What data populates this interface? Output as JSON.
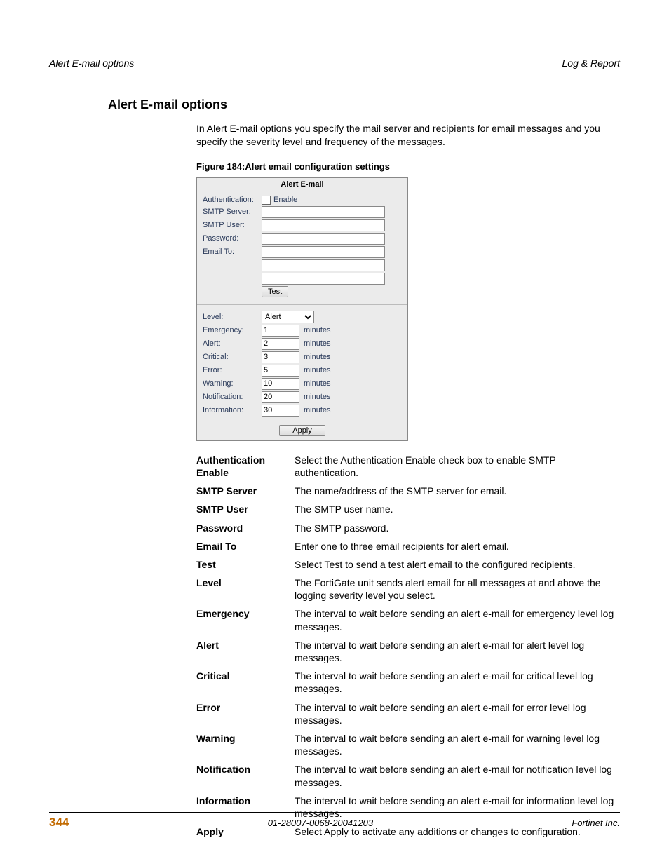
{
  "header": {
    "left": "Alert E-mail options",
    "right": "Log & Report"
  },
  "title": "Alert E-mail options",
  "intro": "In Alert E-mail options you specify the mail server and recipients for email messages and you specify the severity level and frequency of the messages.",
  "figure_caption": "Figure 184:Alert email configuration settings",
  "screenshot": {
    "panel_title": "Alert E-mail",
    "fields": {
      "authentication": "Authentication:",
      "enable": "Enable",
      "smtp_server": "SMTP Server:",
      "smtp_user": "SMTP User:",
      "password": "Password:",
      "email_to": "Email To:",
      "test": "Test",
      "level": "Level:",
      "level_value": "Alert",
      "emergency": "Emergency:",
      "alert": "Alert:",
      "critical": "Critical:",
      "error": "Error:",
      "warning": "Warning:",
      "notification": "Notification:",
      "information": "Information:",
      "minutes": "minutes",
      "apply": "Apply"
    },
    "values": {
      "emergency": "1",
      "alert": "2",
      "critical": "3",
      "error": "5",
      "warning": "10",
      "notification": "20",
      "information": "30"
    }
  },
  "definitions": [
    {
      "term": "Authentication Enable",
      "desc": "Select the Authentication Enable check box to enable SMTP authentication."
    },
    {
      "term": "SMTP Server",
      "desc": "The name/address of the SMTP server for email."
    },
    {
      "term": "SMTP User",
      "desc": "The SMTP user name."
    },
    {
      "term": "Password",
      "desc": "The SMTP password."
    },
    {
      "term": "Email To",
      "desc": "Enter one to three email recipients for alert email."
    },
    {
      "term": "Test",
      "desc": "Select Test to send a test alert email to the configured recipients."
    },
    {
      "term": "Level",
      "desc": "The FortiGate unit sends alert email for all messages at and above the logging severity level you select."
    },
    {
      "term": "Emergency",
      "desc": "The interval to wait before sending an alert e-mail for emergency level log messages."
    },
    {
      "term": "Alert",
      "desc": "The interval to wait before sending an alert e-mail for alert level log messages."
    },
    {
      "term": "Critical",
      "desc": "The interval to wait before sending an alert e-mail for critical level log messages."
    },
    {
      "term": "Error",
      "desc": "The interval to wait before sending an alert e-mail for error level log messages."
    },
    {
      "term": "Warning",
      "desc": "The interval to wait before sending an alert e-mail for warning level log messages."
    },
    {
      "term": "Notification",
      "desc": "The interval to wait before sending an alert e-mail for notification level log messages."
    },
    {
      "term": "Information",
      "desc": "The interval to wait before sending an alert e-mail for information level log messages."
    },
    {
      "term": "Apply",
      "desc": "Select Apply to activate any additions or changes to configuration."
    }
  ],
  "footer": {
    "page": "344",
    "docid": "01-28007-0068-20041203",
    "company": "Fortinet Inc."
  }
}
